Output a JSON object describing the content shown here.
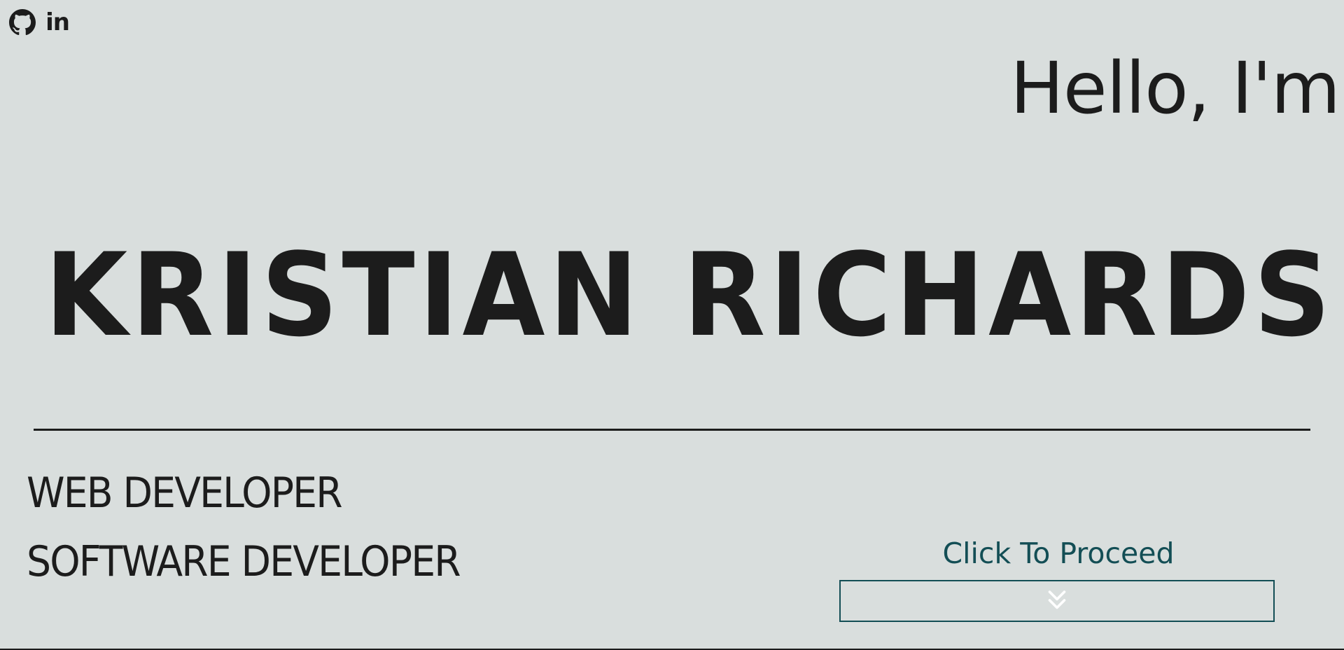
{
  "social": {
    "github_icon": "github-icon",
    "linkedin_icon": "linkedin-icon",
    "linkedin_glyph": "in"
  },
  "hero": {
    "greeting": "Hello, I'm",
    "name": "KRISTIAN RICHARDS",
    "roles": [
      "WEB DEVELOPER",
      "SOFTWARE DEVELOPER"
    ]
  },
  "cta": {
    "label": "Click To Proceed",
    "icon": "double-chevron-down-icon"
  },
  "colors": {
    "background": "#d9dedd",
    "text": "#1c1c1c",
    "accent": "#134e55",
    "chevron": "#ffffff"
  }
}
